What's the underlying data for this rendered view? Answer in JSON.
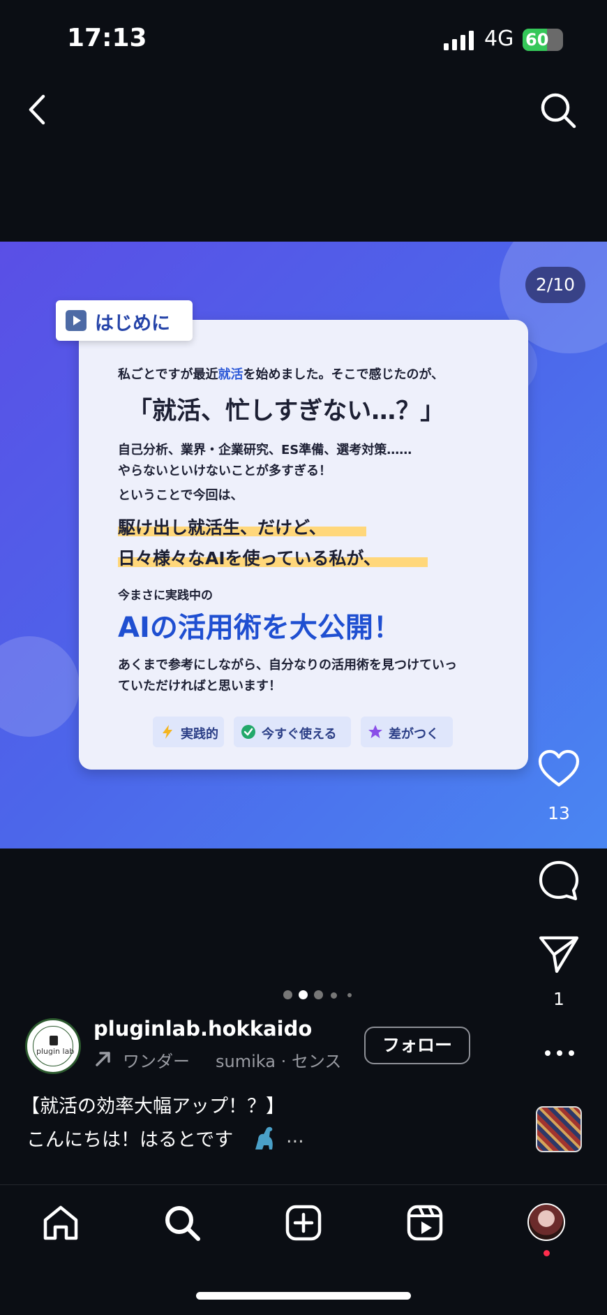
{
  "status_bar": {
    "time": "17:13",
    "network": "4G",
    "battery": "60",
    "battery_level": 0.6
  },
  "post": {
    "counter": "2/10",
    "card": {
      "tag": "はじめに",
      "line1_pre": "私ごとですが最近",
      "line1_highlight": "就活",
      "line1_post": "を始めました。そこで感じたのが、",
      "headline": "「就活、忙しすぎない…？」",
      "line3": "自己分析、業界・企業研究、ES準備、選考対策……",
      "line4": "やらないといけないことが多すぎる！",
      "line5": "ということで今回は、",
      "highlight1": "駆け出し就活生、だけど、",
      "highlight2": "日々様々なAIを使っている私が、",
      "line8": "今まさに実践中の",
      "big": "AIの活用術を大公開！",
      "line10": "あくまで参考にしながら、自分なりの活用術を見つけていっ",
      "line11": "ていただければと思います！",
      "chips": [
        {
          "label": "実践的",
          "icon": "lightning-icon"
        },
        {
          "label": "今すぐ使える",
          "icon": "check-circle-icon"
        },
        {
          "label": "差がつく",
          "icon": "star-icon"
        }
      ]
    }
  },
  "actions": {
    "likes": "13",
    "shares": "1"
  },
  "carousel": {
    "current": 2,
    "total_dots": 5
  },
  "caption": {
    "username": "pluginlab.hokkaido",
    "avatar_text": "plugin lab",
    "music_title": "ワンダー",
    "music_artist": "sumika · センス",
    "follow": "フォロー",
    "line1": "【就活の効率大幅アップ！？】",
    "line2": "こんにちは！はるとです",
    "more": "..."
  },
  "colors": {
    "accent_blue": "#1f4fd1",
    "highlight": "#ffd77a",
    "notification": "#ff2d4d"
  }
}
